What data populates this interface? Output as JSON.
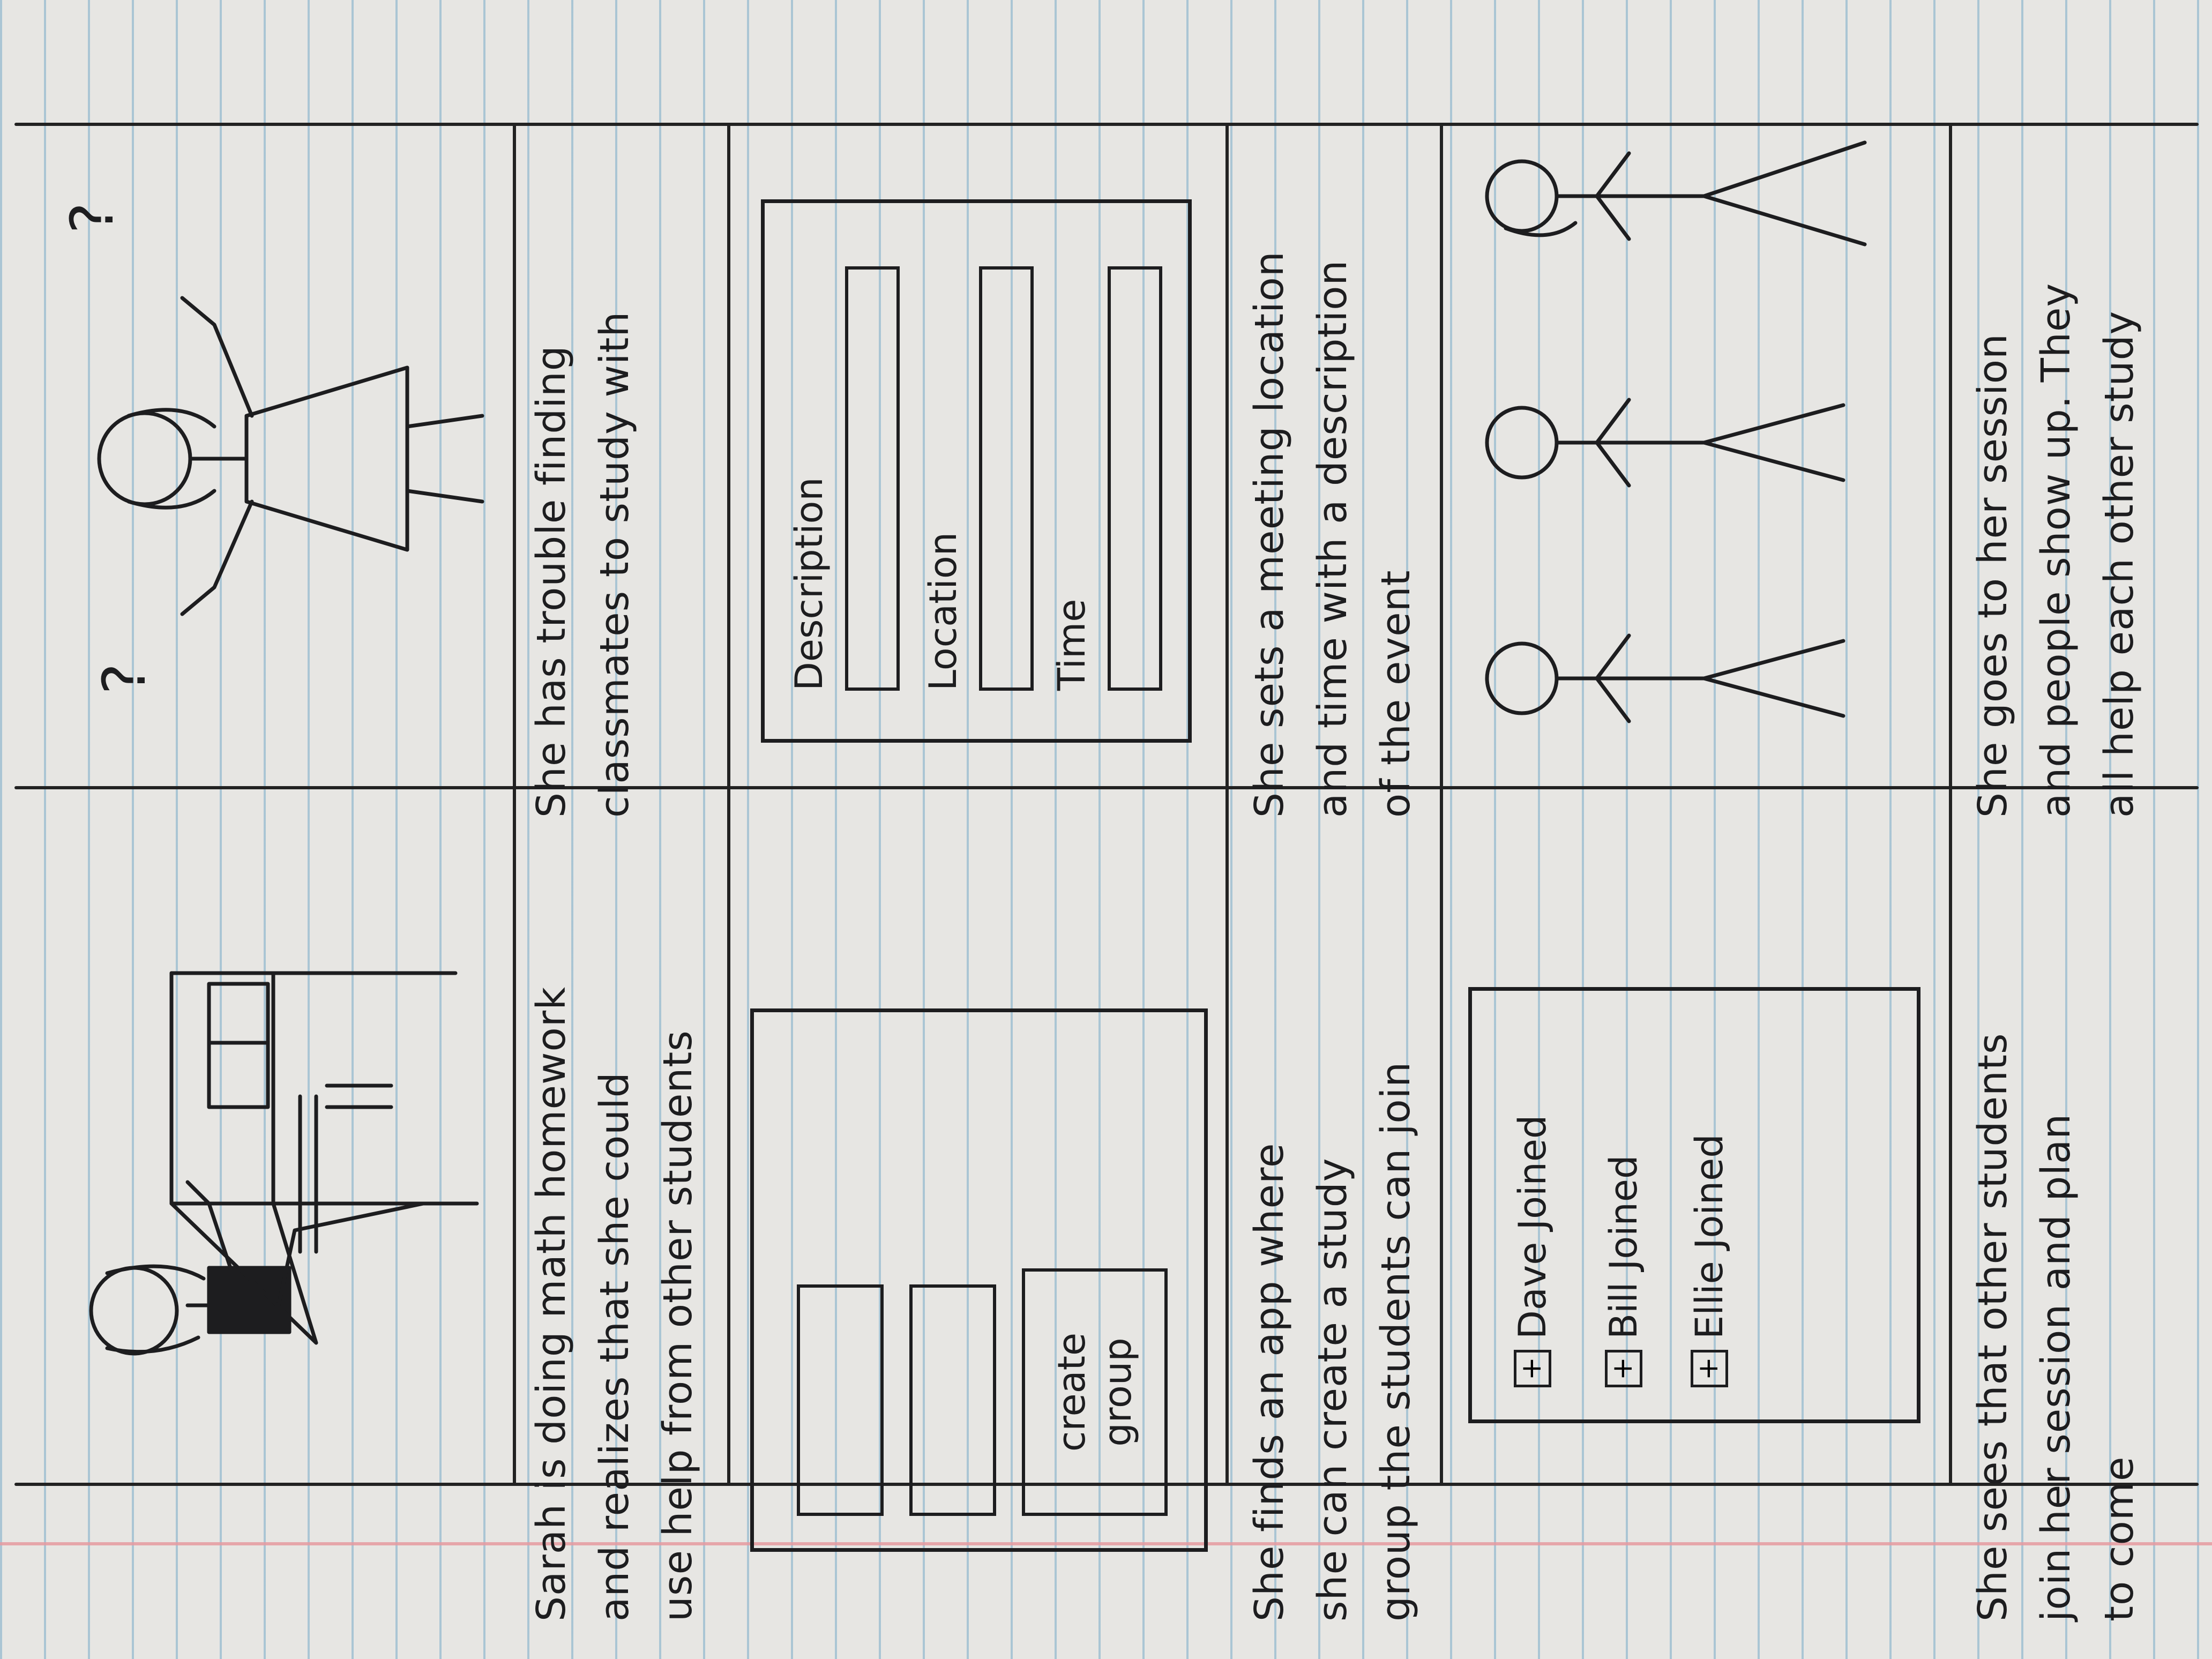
{
  "captions": [
    "Sarah is doing math homework\nand realizes that she could\nuse help from other students",
    "She has trouble finding\nclassmates to study with",
    "She finds an app where\nshe can create a study\ngroup the students can join",
    "She sets a meeting location\nand time with a description\nof the event",
    "She sees that other students\njoin her session and plan\nto come",
    "She goes to her session\nand people show up. They\nall help each other study"
  ],
  "panel3": {
    "button": "create\ngroup"
  },
  "panel4": {
    "fields": [
      "Description",
      "Location",
      "Time"
    ]
  },
  "panel5": {
    "plus_glyph": "+",
    "joined": [
      "Dave Joined",
      "Bill Joined",
      "Ellie Joined"
    ]
  },
  "panel2": {
    "marks": [
      "?",
      "?"
    ]
  }
}
